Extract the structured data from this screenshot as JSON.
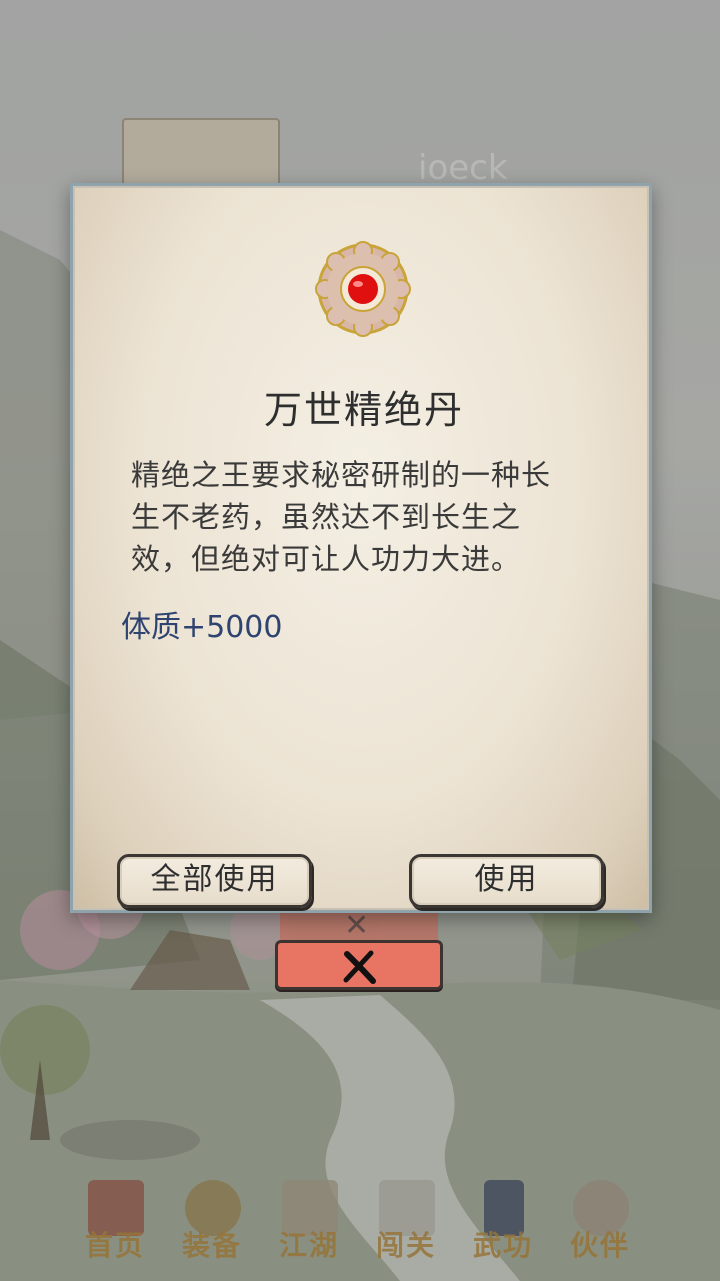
{
  "underlying": {
    "player_name": "ioeck"
  },
  "dialog": {
    "icon": "red-pill-icon",
    "title": "万世精绝丹",
    "description": "精绝之王要求秘密研制的一种长生不老药，虽然达不到长生之效，但绝对可让人功力大进。",
    "stat": "体质+5000",
    "use_all_label": "全部使用",
    "use_label": "使用"
  },
  "close_icon": "close-x-icon",
  "nav": {
    "items": [
      {
        "label": "首页",
        "icon": "home-gate-icon"
      },
      {
        "label": "装备",
        "icon": "armor-icon"
      },
      {
        "label": "江湖",
        "icon": "scroll-map-icon"
      },
      {
        "label": "闯关",
        "icon": "crossed-swords-icon"
      },
      {
        "label": "武功",
        "icon": "book-icon"
      },
      {
        "label": "伙伴",
        "icon": "companions-icon"
      }
    ]
  },
  "colors": {
    "stat_text": "#2f4370",
    "close_button": "#e87563",
    "nav_label": "#b58a3e"
  }
}
